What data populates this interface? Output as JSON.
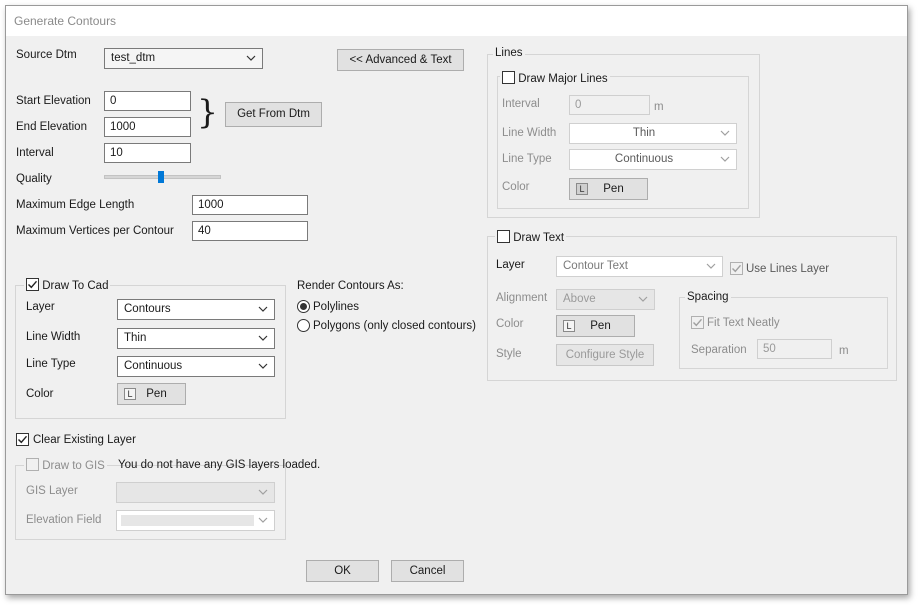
{
  "window": {
    "title": "Generate Contours"
  },
  "source": {
    "label": "Source Dtm",
    "value": "test_dtm"
  },
  "advanced_button": "<< Advanced & Text",
  "elevation": {
    "start_label": "Start Elevation",
    "start_value": "0",
    "end_label": "End Elevation",
    "end_value": "1000",
    "interval_label": "Interval",
    "interval_value": "10",
    "brace": "}",
    "get_from_dtm": "Get From Dtm"
  },
  "quality": {
    "label": "Quality",
    "level": 0.5
  },
  "max_edge": {
    "label": "Maximum Edge Length",
    "value": "1000"
  },
  "max_vertices": {
    "label": "Maximum Vertices per Contour",
    "value": "40"
  },
  "draw_to_cad": {
    "label": "Draw To Cad",
    "checked": true,
    "layer_label": "Layer",
    "layer_value": "Contours",
    "line_width_label": "Line Width",
    "line_width_value": "Thin",
    "line_type_label": "Line Type",
    "line_type_value": "Continuous",
    "color_label": "Color",
    "color_value": "Pen",
    "color_swatch": "L"
  },
  "render": {
    "label": "Render Contours As:",
    "options": [
      "Polylines",
      "Polygons (only closed contours)"
    ],
    "selected": 0
  },
  "clear_layer": {
    "label": "Clear Existing Layer",
    "checked": true
  },
  "gis": {
    "label": "Draw to GIS",
    "checked": false,
    "message": "You do not have any GIS layers loaded.",
    "layer_label": "GIS Layer",
    "layer_value": "",
    "elevation_label": "Elevation Field",
    "elevation_value": ""
  },
  "lines": {
    "group_label": "Lines",
    "major_label": "Draw Major Lines",
    "major_checked": false,
    "interval_label": "Interval",
    "interval_value": "0",
    "interval_unit": "m",
    "line_width_label": "Line Width",
    "line_width_value": "Thin",
    "line_type_label": "Line Type",
    "line_type_value": "Continuous",
    "color_label": "Color",
    "color_value": "Pen",
    "color_swatch": "L"
  },
  "text": {
    "label": "Draw Text",
    "checked": false,
    "layer_label": "Layer",
    "layer_value": "Contour Text",
    "use_lines_layer": "Use Lines Layer",
    "use_lines_checked": true,
    "alignment_label": "Alignment",
    "alignment_value": "Above",
    "color_label": "Color",
    "color_value": "Pen",
    "color_swatch": "L",
    "style_label": "Style",
    "style_button": "Configure Style",
    "spacing": {
      "label": "Spacing",
      "fit_label": "Fit Text Neatly",
      "fit_checked": true,
      "separation_label": "Separation",
      "separation_value": "50",
      "separation_unit": "m"
    }
  },
  "buttons": {
    "ok": "OK",
    "cancel": "Cancel"
  },
  "icons": [
    "chevron-down-icon",
    "checkmark-icon"
  ]
}
